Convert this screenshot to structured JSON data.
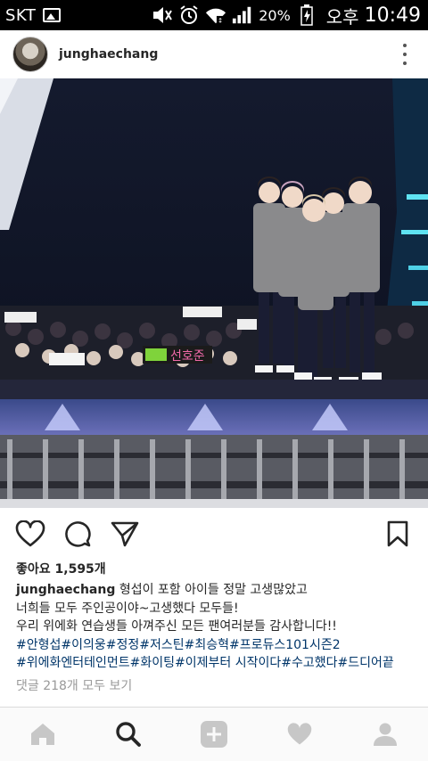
{
  "status_bar": {
    "carrier": "SKT",
    "battery": "20%",
    "ampm": "오후",
    "time": "10:49",
    "icons": [
      "image-icon",
      "mute-icon",
      "alarm-icon",
      "wifi-icon",
      "signal-icon",
      "battery-icon"
    ]
  },
  "post": {
    "username": "junghaechang",
    "likes": "좋아요 1,595개",
    "caption": {
      "username": "junghaechang",
      "lines": [
        "형섭이 포함 아이들 정말 고생많았고",
        "너희들 모두 주인공이야~고생했다 모두들!",
        "우리 위에화 연습생들 아껴주신 모든 팬여러분들 감사합니다!!"
      ],
      "hashtag_lines": [
        "#안형섭#이의웅#정정#저스틴#최승혁#프로듀스101시즌2",
        "#위에화엔터테인먼트#화이팅#이제부터 시작이다#수고했다#드디어끝"
      ]
    },
    "view_comments": "댓글 218개 모두 보기",
    "image_text": {
      "fan_banner": "선호준"
    }
  },
  "actions": [
    "heart-icon",
    "comment-icon",
    "share-icon",
    "bookmark-icon"
  ],
  "nav": [
    "home-icon",
    "search-icon",
    "add-post-icon",
    "activity-heart-icon",
    "profile-icon"
  ]
}
